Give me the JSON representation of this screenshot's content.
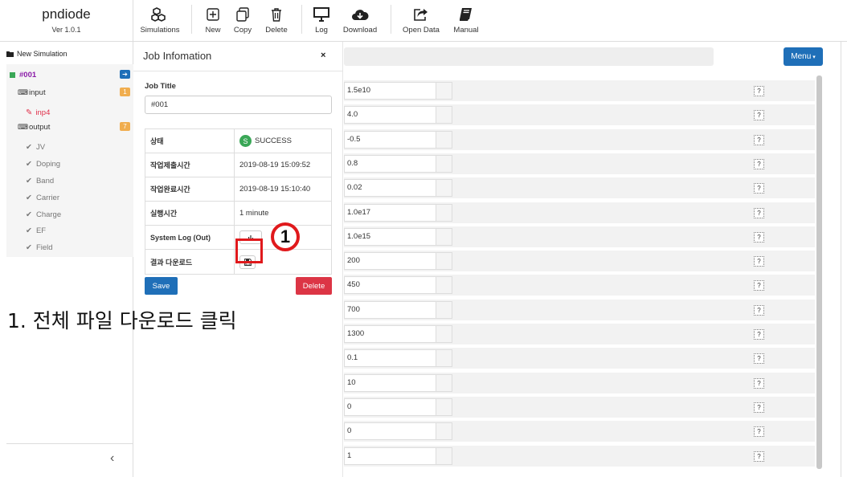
{
  "app": {
    "name": "pndiode",
    "version": "Ver 1.0.1"
  },
  "toolbar": {
    "simulations": "Simulations",
    "new": "New",
    "copy": "Copy",
    "delete": "Delete",
    "log": "Log",
    "download": "Download",
    "open_data": "Open Data",
    "manual": "Manual"
  },
  "sidebar": {
    "new_simulation": "New Simulation",
    "job": "#001",
    "input": "input",
    "input_count": "1",
    "inp4": "inp4",
    "output": "output",
    "output_count": "7",
    "outputs": [
      "JV",
      "Doping",
      "Band",
      "Carrier",
      "Charge",
      "EF",
      "Field"
    ]
  },
  "main": {
    "menu_label": "Menu",
    "params": [
      "1.5e10",
      "4.0",
      "-0.5",
      "0.8",
      "0.02",
      "1.0e17",
      "1.0e15",
      "200",
      "450",
      "700",
      "1300",
      "0.1",
      "10",
      "0",
      "0",
      "1"
    ],
    "help_label": "?"
  },
  "panel": {
    "title": "Job Infomation",
    "close": "×",
    "job_title_label": "Job Title",
    "job_title_value": "#001",
    "rows": [
      {
        "key": "상태",
        "value": "SUCCESS"
      },
      {
        "key": "작업제출시간",
        "value": "2019-08-19 15:09:52"
      },
      {
        "key": "작업완료시간",
        "value": "2019-08-19 15:10:40"
      },
      {
        "key": "실행시간",
        "value": "1 minute"
      },
      {
        "key": "System Log (Out)",
        "value": ""
      },
      {
        "key": "결과 다운로드",
        "value": ""
      }
    ],
    "status_icon_letter": "S",
    "save": "Save",
    "delete": "Delete"
  },
  "annotation": {
    "step_number": "1",
    "caption": "1. 전체 파일 다운로드 클릭"
  },
  "colors": {
    "primary": "#1f6fb8",
    "danger": "#dc3545",
    "success": "#3aa757",
    "highlight": "#e0191c",
    "job": "#8a1aa8",
    "inp": "#e0304a"
  }
}
